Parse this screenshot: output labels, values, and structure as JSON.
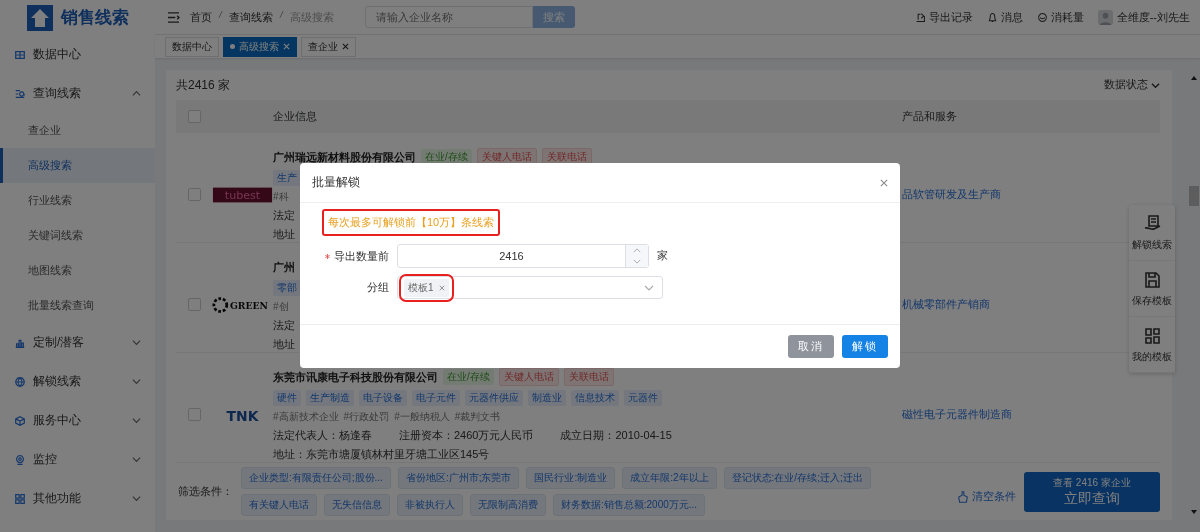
{
  "app": {
    "title": "销售线索"
  },
  "sidebar": {
    "items": [
      {
        "kind": "link",
        "label": "数据中心"
      },
      {
        "kind": "group",
        "label": "查询线索",
        "expanded": true,
        "children": [
          {
            "label": "查企业",
            "selected": false
          },
          {
            "label": "高级搜索",
            "selected": true
          },
          {
            "label": "行业线索",
            "selected": false
          },
          {
            "label": "关键词线索",
            "selected": false
          },
          {
            "label": "地图线索",
            "selected": false
          },
          {
            "label": "批量线索查询",
            "selected": false
          }
        ]
      },
      {
        "kind": "group",
        "label": "定制/潜客",
        "expanded": false
      },
      {
        "kind": "group",
        "label": "解锁线索",
        "expanded": false
      },
      {
        "kind": "group",
        "label": "服务中心",
        "expanded": false
      },
      {
        "kind": "group",
        "label": "监控",
        "expanded": false
      },
      {
        "kind": "group",
        "label": "其他功能",
        "expanded": false
      }
    ]
  },
  "topbar": {
    "breadcrumb": [
      "首页",
      "查询线索",
      "高级搜索"
    ],
    "search": {
      "placeholder": "请输入企业名称",
      "button": "搜索"
    },
    "actions": [
      "导出记录",
      "消息",
      "消耗量"
    ],
    "user": "全维度--刘先生"
  },
  "tabs": [
    {
      "label": "数据中心",
      "selected": false,
      "closable": false
    },
    {
      "label": "高级搜索",
      "selected": true,
      "closable": true
    },
    {
      "label": "查企业",
      "selected": false,
      "closable": true
    }
  ],
  "results": {
    "total": "共2416 家",
    "status_filter": "数据状态",
    "select_all_checked": false,
    "columns": [
      "企业信息",
      "产品和服务"
    ],
    "rows": [
      {
        "checked": false,
        "logo": "tubest",
        "name": "广州瑞远新材料股份有限公司",
        "status": "在业/存续",
        "phone_tags": [
          "关键人电话",
          "关联电话"
        ],
        "tags": [
          "生产"
        ],
        "hashtags": [
          "#科"
        ],
        "details": [
          "法定"
        ],
        "address": "地址",
        "product": "品软管研发及生产商"
      },
      {
        "checked": false,
        "logo": "GREEN",
        "name": "广州",
        "tags": [
          "零部"
        ],
        "hashtags": [
          "#创"
        ],
        "details": [
          "法定"
        ],
        "address": "地址",
        "product": "机械零部件产销商"
      },
      {
        "checked": false,
        "logo": "TNK",
        "name": "东莞市讯康电子科技股份有限公司",
        "status": "在业/存续",
        "phone_tags": [
          "关键人电话",
          "关联电话"
        ],
        "tags": [
          "硬件",
          "生产制造",
          "电子设备",
          "电子元件",
          "元器件供应",
          "制造业",
          "信息技术",
          "元器件"
        ],
        "hashtags": [
          "#高新技术企业",
          "#行政处罚",
          "#一般纳税人",
          "#裁判文书"
        ],
        "details": [
          "法定代表人：杨逢春",
          "注册资本：2460万元人民币",
          "成立日期：2010-04-15"
        ],
        "address": "地址：东莞市塘厦镇林村里牙塘工业区145号",
        "product": "磁性电子元器件制造商"
      }
    ]
  },
  "filters": {
    "label": "筛选条件：",
    "chips": [
      "企业类型:有限责任公司;股份...",
      "省份地区:广州市;东莞市",
      "国民行业:制造业",
      "成立年限:2年以上",
      "登记状态:在业/存续;迁入;迁出",
      "有关键人电话",
      "无失信信息",
      "非被执行人",
      "无限制高消费",
      "财务数据:销售总额:2000万元..."
    ],
    "clear": "清空条件",
    "submit": {
      "count_line": "查看 2416 家企业",
      "label": "立即查询"
    }
  },
  "side_panel": [
    "解锁线索",
    "保存模板",
    "我的模板"
  ],
  "modal": {
    "title": "批量解锁",
    "notice": "每次最多可解锁前【10万】条线索",
    "fields": [
      {
        "kind": "number",
        "label": "导出数量前",
        "required": true,
        "value": "2416",
        "unit": "家"
      },
      {
        "kind": "select",
        "label": "分组",
        "required": false,
        "tags": [
          "模板1"
        ]
      }
    ],
    "buttons": [
      {
        "label": "取消",
        "kind": "secondary"
      },
      {
        "label": "解锁",
        "kind": "primary"
      }
    ]
  }
}
